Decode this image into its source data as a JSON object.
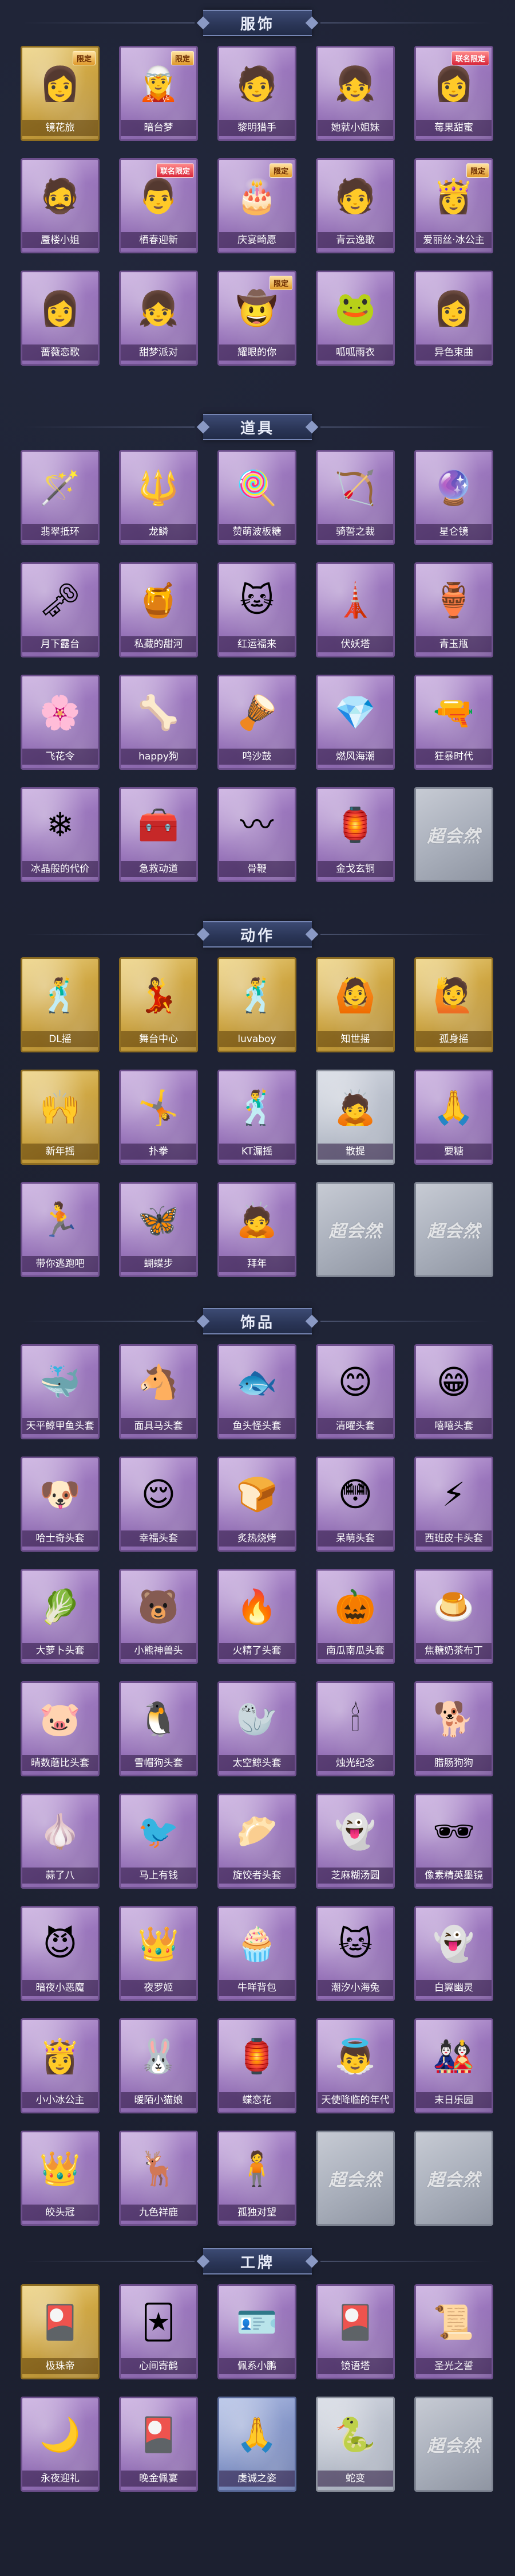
{
  "sections": [
    {
      "title": "服饰",
      "items": [
        {
          "label": "镜花旅",
          "tier": "gold",
          "badge": "限定",
          "icon": "character-portrait-icon",
          "glyph": "👩"
        },
        {
          "label": "暗台梦",
          "tier": "purple",
          "badge": "限定",
          "icon": "character-portrait-icon",
          "glyph": "🧝"
        },
        {
          "label": "黎明猎手",
          "tier": "purple",
          "badge": "",
          "icon": "character-portrait-icon",
          "glyph": "🧑"
        },
        {
          "label": "她就小姐妹",
          "tier": "purple",
          "badge": "",
          "icon": "character-portrait-icon",
          "glyph": "👧"
        },
        {
          "label": "莓果甜蜜",
          "tier": "purple",
          "badge": "联名限定",
          "icon": "character-portrait-icon",
          "glyph": "👩"
        },
        {
          "label": "蜃楼小姐",
          "tier": "purple",
          "badge": "",
          "icon": "character-portrait-icon",
          "glyph": "🧔"
        },
        {
          "label": "栖春迎新",
          "tier": "purple",
          "badge": "联名限定",
          "icon": "character-portrait-icon",
          "glyph": "👨"
        },
        {
          "label": "庆宴畸愿",
          "tier": "purple",
          "badge": "限定",
          "icon": "character-portrait-icon",
          "glyph": "🎂"
        },
        {
          "label": "青云逸歌",
          "tier": "purple",
          "badge": "",
          "icon": "character-portrait-icon",
          "glyph": "🧑"
        },
        {
          "label": "爱丽丝·冰公主",
          "tier": "purple",
          "badge": "限定",
          "icon": "character-portrait-icon",
          "glyph": "👸"
        },
        {
          "label": "蔷薇恋歌",
          "tier": "purple",
          "badge": "",
          "icon": "character-portrait-icon",
          "glyph": "👩"
        },
        {
          "label": "甜梦派对",
          "tier": "purple",
          "badge": "",
          "icon": "character-portrait-icon",
          "glyph": "👧"
        },
        {
          "label": "耀眼的你",
          "tier": "purple",
          "badge": "限定",
          "icon": "character-portrait-icon",
          "glyph": "🤠"
        },
        {
          "label": "呱呱雨衣",
          "tier": "purple",
          "badge": "",
          "icon": "character-portrait-icon",
          "glyph": "🐸"
        },
        {
          "label": "异色束曲",
          "tier": "purple",
          "badge": "",
          "icon": "character-portrait-icon",
          "glyph": "👩"
        }
      ]
    },
    {
      "title": "道具",
      "items": [
        {
          "label": "翡翠抵环",
          "tier": "purple",
          "badge": "",
          "icon": "staff-icon",
          "glyph": "🪄"
        },
        {
          "label": "龙鳞",
          "tier": "purple",
          "badge": "",
          "icon": "staff-icon",
          "glyph": "🔱"
        },
        {
          "label": "赞萌波板糖",
          "tier": "purple",
          "badge": "",
          "icon": "wand-icon",
          "glyph": "🍭"
        },
        {
          "label": "骑誓之裁",
          "tier": "purple",
          "badge": "",
          "icon": "bow-icon",
          "glyph": "🏹"
        },
        {
          "label": "星仑镜",
          "tier": "purple",
          "badge": "",
          "icon": "mirror-icon",
          "glyph": "🔮"
        },
        {
          "label": "月下露台",
          "tier": "purple",
          "badge": "",
          "icon": "scepter-icon",
          "glyph": "🗝"
        },
        {
          "label": "私藏的甜河",
          "tier": "purple",
          "badge": "",
          "icon": "treasure-icon",
          "glyph": "🍯"
        },
        {
          "label": "红运福来",
          "tier": "purple",
          "badge": "",
          "icon": "lucky-cat-icon",
          "glyph": "🐱"
        },
        {
          "label": "伏妖塔",
          "tier": "purple",
          "badge": "",
          "icon": "pagoda-icon",
          "glyph": "🗼"
        },
        {
          "label": "青玉瓶",
          "tier": "purple",
          "badge": "",
          "icon": "vase-icon",
          "glyph": "🏺"
        },
        {
          "label": "飞花令",
          "tier": "purple",
          "badge": "",
          "icon": "flower-icon",
          "glyph": "🌸"
        },
        {
          "label": "happy狗",
          "tier": "purple",
          "badge": "",
          "icon": "bone-icon",
          "glyph": "🦴"
        },
        {
          "label": "鸣沙鼓",
          "tier": "purple",
          "badge": "",
          "icon": "drum-icon",
          "glyph": "🪘"
        },
        {
          "label": "燃风海潮",
          "tier": "purple",
          "badge": "",
          "icon": "gem-icon",
          "glyph": "💎"
        },
        {
          "label": "狂暴时代",
          "tier": "purple",
          "badge": "",
          "icon": "revolver-icon",
          "glyph": "🔫"
        },
        {
          "label": "冰晶般的代价",
          "tier": "purple",
          "badge": "",
          "icon": "ice-flower-icon",
          "glyph": "❄"
        },
        {
          "label": "急救动道",
          "tier": "purple",
          "badge": "",
          "icon": "medkit-icon",
          "glyph": "🧰"
        },
        {
          "label": "骨鞭",
          "tier": "purple",
          "badge": "",
          "icon": "whip-icon",
          "glyph": "〰"
        },
        {
          "label": "金戈玄铜",
          "tier": "purple",
          "badge": "",
          "icon": "lantern-icon",
          "glyph": "🏮"
        },
        {
          "label": "",
          "tier": "placeholder",
          "badge": "",
          "icon": "",
          "glyph": "超会然"
        }
      ]
    },
    {
      "title": "动作",
      "items": [
        {
          "label": "DL摇",
          "tier": "gold",
          "badge": "",
          "icon": "dance-pose-icon",
          "glyph": "🕺"
        },
        {
          "label": "舞台中心",
          "tier": "gold",
          "badge": "",
          "icon": "dance-pose-icon",
          "glyph": "💃"
        },
        {
          "label": "luvaboy",
          "tier": "gold",
          "badge": "",
          "icon": "dance-pose-icon",
          "glyph": "🕺"
        },
        {
          "label": "知世摇",
          "tier": "gold",
          "badge": "",
          "icon": "dance-pose-icon",
          "glyph": "🙆"
        },
        {
          "label": "孤身摇",
          "tier": "gold",
          "badge": "",
          "icon": "dance-pose-icon",
          "glyph": "🙋"
        },
        {
          "label": "新年摇",
          "tier": "gold",
          "badge": "",
          "icon": "dance-pose-icon",
          "glyph": "🙌"
        },
        {
          "label": "扑拳",
          "tier": "purple",
          "badge": "",
          "icon": "dance-pose-icon",
          "glyph": "🤸"
        },
        {
          "label": "KT漏摇",
          "tier": "purple",
          "badge": "",
          "icon": "dance-pose-icon",
          "glyph": "🕺"
        },
        {
          "label": "散提",
          "tier": "grey",
          "badge": "",
          "icon": "dance-pose-icon",
          "glyph": "🙇"
        },
        {
          "label": "要糖",
          "tier": "purple",
          "badge": "",
          "icon": "dance-pose-icon",
          "glyph": "🙏"
        },
        {
          "label": "带你逃跑吧",
          "tier": "purple",
          "badge": "",
          "icon": "dance-pose-icon",
          "glyph": "🏃"
        },
        {
          "label": "蝴蝶步",
          "tier": "purple",
          "badge": "",
          "icon": "dance-pose-icon",
          "glyph": "🦋"
        },
        {
          "label": "拜年",
          "tier": "purple",
          "badge": "",
          "icon": "dance-pose-icon",
          "glyph": "🙇"
        },
        {
          "label": "",
          "tier": "placeholder",
          "badge": "",
          "icon": "",
          "glyph": "超会然"
        },
        {
          "label": "",
          "tier": "placeholder",
          "badge": "",
          "icon": "",
          "glyph": "超会然"
        }
      ]
    },
    {
      "title": "饰品",
      "items": [
        {
          "label": "天平鲸甲鱼头套",
          "tier": "purple",
          "badge": "",
          "icon": "whale-head-icon",
          "glyph": "🐳"
        },
        {
          "label": "面具马头套",
          "tier": "purple",
          "badge": "",
          "icon": "horse-head-icon",
          "glyph": "🐴"
        },
        {
          "label": "鱼头怪头套",
          "tier": "purple",
          "badge": "",
          "icon": "fish-head-icon",
          "glyph": "🐟"
        },
        {
          "label": "清曜头套",
          "tier": "purple",
          "badge": "",
          "icon": "smiley-icon",
          "glyph": "😊"
        },
        {
          "label": "嘻嘻头套",
          "tier": "purple",
          "badge": "",
          "icon": "grin-icon",
          "glyph": "😁"
        },
        {
          "label": "哈士奇头套",
          "tier": "purple",
          "badge": "",
          "icon": "dog-head-icon",
          "glyph": "🐶"
        },
        {
          "label": "幸福头套",
          "tier": "purple",
          "badge": "",
          "icon": "smiley-icon",
          "glyph": "😌"
        },
        {
          "label": "炙热烧烤",
          "tier": "purple",
          "badge": "",
          "icon": "bread-icon",
          "glyph": "🍞"
        },
        {
          "label": "呆萌头套",
          "tier": "purple",
          "badge": "",
          "icon": "smiley-icon",
          "glyph": "😳"
        },
        {
          "label": "西班皮卡头套",
          "tier": "purple",
          "badge": "",
          "icon": "pikachu-icon",
          "glyph": "⚡"
        },
        {
          "label": "大萝卜头套",
          "tier": "purple",
          "badge": "",
          "icon": "radish-icon",
          "glyph": "🥬"
        },
        {
          "label": "小熊神兽头",
          "tier": "purple",
          "badge": "",
          "icon": "bear-head-icon",
          "glyph": "🐻"
        },
        {
          "label": "火精了头套",
          "tier": "purple",
          "badge": "",
          "icon": "fire-icon",
          "glyph": "🔥"
        },
        {
          "label": "南瓜南瓜头套",
          "tier": "purple",
          "badge": "",
          "icon": "pumpkin-icon",
          "glyph": "🎃"
        },
        {
          "label": "焦糖奶茶布丁",
          "tier": "purple",
          "badge": "",
          "icon": "pudding-icon",
          "glyph": "🍮"
        },
        {
          "label": "晴数蘑比头套",
          "tier": "purple",
          "badge": "",
          "icon": "pig-head-icon",
          "glyph": "🐷"
        },
        {
          "label": "雪帽狗头套",
          "tier": "purple",
          "badge": "",
          "icon": "penguin-icon",
          "glyph": "🐧"
        },
        {
          "label": "太空鲸头套",
          "tier": "purple",
          "badge": "",
          "icon": "seal-icon",
          "glyph": "🦭"
        },
        {
          "label": "烛光纪念",
          "tier": "purple",
          "badge": "",
          "icon": "candle-icon",
          "glyph": "🕯"
        },
        {
          "label": "腊肠狗狗",
          "tier": "purple",
          "badge": "",
          "icon": "dog-head-icon",
          "glyph": "🐕"
        },
        {
          "label": "蒜了八",
          "tier": "purple",
          "badge": "",
          "icon": "garlic-icon",
          "glyph": "🧄"
        },
        {
          "label": "马上有钱",
          "tier": "purple",
          "badge": "",
          "icon": "bird-icon",
          "glyph": "🐦"
        },
        {
          "label": "旋饺者头套",
          "tier": "purple",
          "badge": "",
          "icon": "dumpling-icon",
          "glyph": "🥟"
        },
        {
          "label": "芝麻糊汤圆",
          "tier": "purple",
          "badge": "",
          "icon": "ghost-icon",
          "glyph": "👻"
        },
        {
          "label": "像素精英墨镜",
          "tier": "purple",
          "badge": "",
          "icon": "sunglasses-icon",
          "glyph": "🕶"
        },
        {
          "label": "暗夜小恶魔",
          "tier": "purple",
          "badge": "",
          "icon": "imp-icon",
          "glyph": "😈"
        },
        {
          "label": "夜罗姬",
          "tier": "purple",
          "badge": "",
          "icon": "crown-icon",
          "glyph": "👑"
        },
        {
          "label": "牛咩背包",
          "tier": "purple",
          "badge": "",
          "icon": "cake-icon",
          "glyph": "🧁"
        },
        {
          "label": "潮汐小海兔",
          "tier": "purple",
          "badge": "",
          "icon": "cat-icon",
          "glyph": "🐱"
        },
        {
          "label": "白翼幽灵",
          "tier": "purple",
          "badge": "",
          "icon": "ghost-icon",
          "glyph": "👻"
        },
        {
          "label": "小小冰公主",
          "tier": "purple",
          "badge": "",
          "icon": "princess-icon",
          "glyph": "👸"
        },
        {
          "label": "暖陌小猫娘",
          "tier": "purple",
          "badge": "",
          "icon": "bunny-icon",
          "glyph": "🐰"
        },
        {
          "label": "蝶恋花",
          "tier": "purple",
          "badge": "",
          "icon": "lantern-icon",
          "glyph": "🏮"
        },
        {
          "label": "天使降临的年代",
          "tier": "purple",
          "badge": "",
          "icon": "angel-icon",
          "glyph": "👼"
        },
        {
          "label": "末日乐园",
          "tier": "purple",
          "badge": "",
          "icon": "doll-icon",
          "glyph": "🎎"
        },
        {
          "label": "皎头冠",
          "tier": "purple",
          "badge": "",
          "icon": "crown-icon",
          "glyph": "👑"
        },
        {
          "label": "九色祥鹿",
          "tier": "purple",
          "badge": "",
          "icon": "deer-icon",
          "glyph": "🦌"
        },
        {
          "label": "孤独对望",
          "tier": "purple",
          "badge": "",
          "icon": "figure-icon",
          "glyph": "🧍"
        },
        {
          "label": "",
          "tier": "placeholder",
          "badge": "",
          "icon": "",
          "glyph": "超会然"
        },
        {
          "label": "",
          "tier": "placeholder",
          "badge": "",
          "icon": "",
          "glyph": "超会然"
        }
      ]
    },
    {
      "title": "工牌",
      "items": [
        {
          "label": "极珠帝",
          "tier": "gold",
          "badge": "",
          "icon": "card-icon",
          "glyph": "🎴"
        },
        {
          "label": "心间寄鹤",
          "tier": "purple",
          "badge": "",
          "icon": "card-icon",
          "glyph": "🃏"
        },
        {
          "label": "佩系小鹏",
          "tier": "purple",
          "badge": "",
          "icon": "card-icon",
          "glyph": "🪪"
        },
        {
          "label": "镜语塔",
          "tier": "purple",
          "badge": "",
          "icon": "card-icon",
          "glyph": "🎴"
        },
        {
          "label": "圣光之誓",
          "tier": "purple",
          "badge": "",
          "icon": "card-icon",
          "glyph": "📜"
        },
        {
          "label": "永夜迎礼",
          "tier": "purple",
          "badge": "",
          "icon": "card-icon",
          "glyph": "🌙"
        },
        {
          "label": "晚金佩宴",
          "tier": "purple",
          "badge": "",
          "icon": "card-icon",
          "glyph": "🎴"
        },
        {
          "label": "虔诚之姿",
          "tier": "blue",
          "badge": "",
          "icon": "card-icon",
          "glyph": "🙏"
        },
        {
          "label": "蛇变",
          "tier": "grey",
          "badge": "",
          "icon": "card-icon",
          "glyph": "🐍"
        },
        {
          "label": "",
          "tier": "placeholder",
          "badge": "",
          "icon": "",
          "glyph": "超会然"
        }
      ]
    }
  ]
}
